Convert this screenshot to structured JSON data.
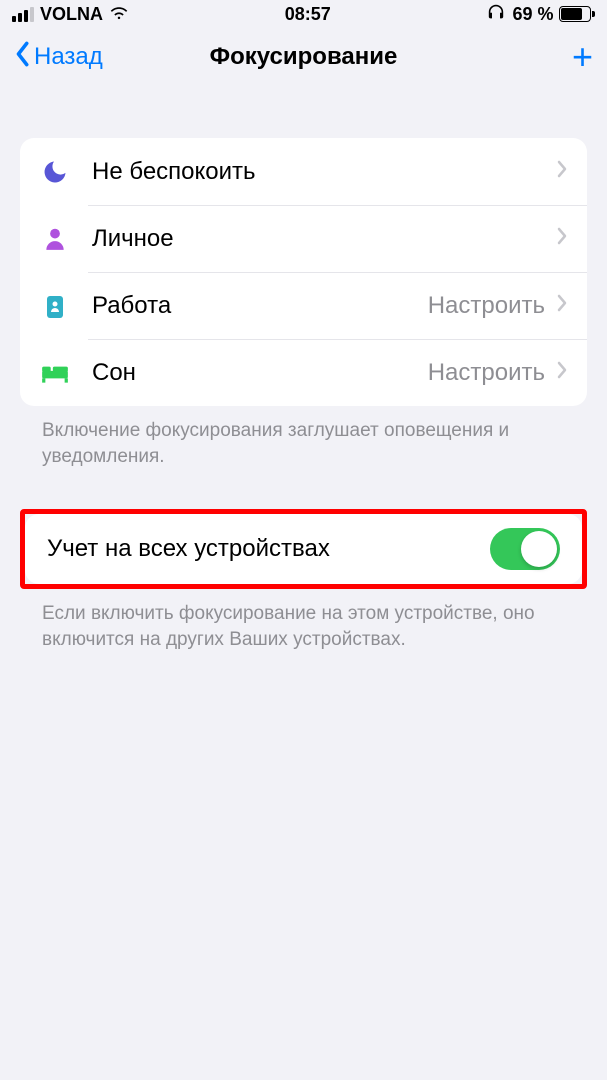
{
  "status": {
    "carrier": "VOLNA",
    "time": "08:57",
    "battery_percent": "69 %"
  },
  "nav": {
    "back": "Назад",
    "title": "Фокусирование"
  },
  "focus_modes": [
    {
      "label": "Не беспокоить",
      "detail": ""
    },
    {
      "label": "Личное",
      "detail": ""
    },
    {
      "label": "Работа",
      "detail": "Настроить"
    },
    {
      "label": "Сон",
      "detail": "Настроить"
    }
  ],
  "footer1": "Включение фокусирования заглушает оповещения и уведомления.",
  "share": {
    "label": "Учет на всех устройствах",
    "on": true
  },
  "footer2": "Если включить фокусирование на этом устройстве, оно включится на других Ваших устройствах."
}
